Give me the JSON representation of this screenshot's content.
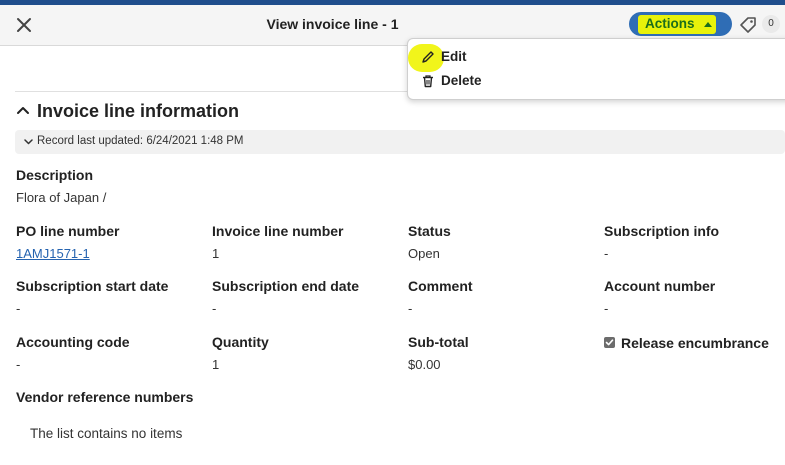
{
  "header": {
    "title": "View invoice line - 1",
    "actions_label": "Actions",
    "tag_count": "0"
  },
  "actions_menu": {
    "items": [
      {
        "label": "Edit",
        "icon": "pencil-icon"
      },
      {
        "label": "Delete",
        "icon": "trash-icon"
      }
    ]
  },
  "section": {
    "title": "Invoice line information",
    "record_meta": "Record last updated: 6/24/2021 1:48 PM"
  },
  "fields": {
    "description": {
      "label": "Description",
      "value": "Flora of Japan /"
    },
    "po_line_number": {
      "label": "PO line number",
      "value": "1AMJ1571-1"
    },
    "invoice_line_number": {
      "label": "Invoice line number",
      "value": "1"
    },
    "status": {
      "label": "Status",
      "value": "Open"
    },
    "subscription_info": {
      "label": "Subscription info",
      "value": "-"
    },
    "subscription_start_date": {
      "label": "Subscription start date",
      "value": "-"
    },
    "subscription_end_date": {
      "label": "Subscription end date",
      "value": "-"
    },
    "comment": {
      "label": "Comment",
      "value": "-"
    },
    "account_number": {
      "label": "Account number",
      "value": "-"
    },
    "accounting_code": {
      "label": "Accounting code",
      "value": "-"
    },
    "quantity": {
      "label": "Quantity",
      "value": "1"
    },
    "sub_total": {
      "label": "Sub-total",
      "value": "$0.00"
    },
    "release_encumbrance": {
      "label": "Release encumbrance",
      "checked": true
    }
  },
  "vendor_refs": {
    "label": "Vendor reference numbers",
    "empty_message": "The list contains no items"
  },
  "colors": {
    "brand_blue": "#1f4e8c",
    "actions_button": "#2f6db5",
    "highlight": "#e8f20a",
    "link": "#2563b0"
  }
}
